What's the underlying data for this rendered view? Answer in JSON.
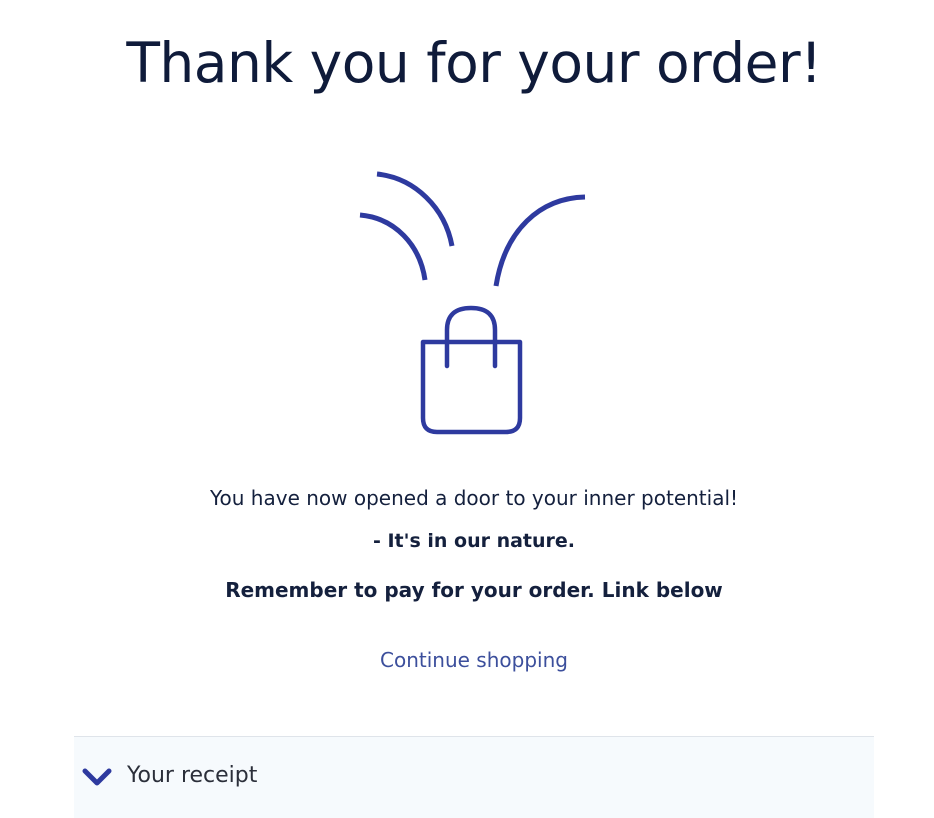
{
  "header": {
    "title": "Thank you for your order!"
  },
  "illustration": {
    "icon": "shopping-bag-icon",
    "color": "#2e3a9f"
  },
  "messages": {
    "line1": "You have now opened a door to your inner potential!",
    "line2": "- It's in our nature.",
    "line3": "Remember to pay for your order. Link below"
  },
  "actions": {
    "continue_label": "Continue shopping",
    "link_color": "#3c4f9c"
  },
  "receipt": {
    "label": "Your receipt",
    "icon": "chevron-down-icon",
    "background": "#f6fafd"
  }
}
